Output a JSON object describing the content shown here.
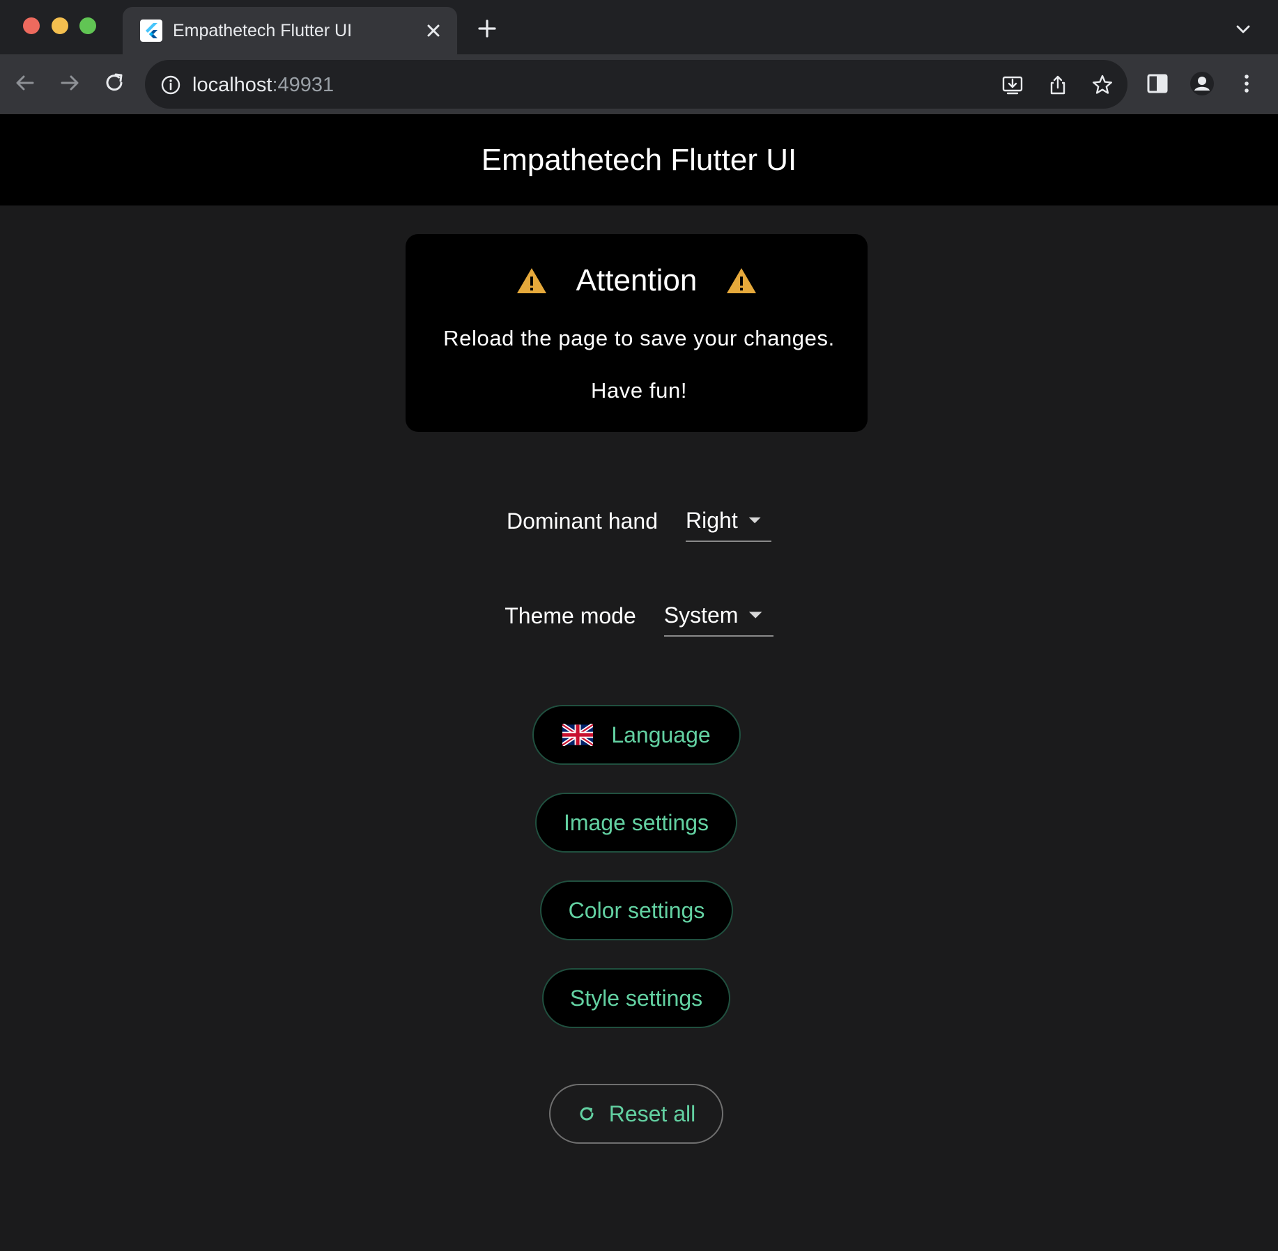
{
  "browser": {
    "tab": {
      "title": "Empathetech Flutter UI"
    },
    "address": {
      "host": "localhost",
      "port": ":49931"
    }
  },
  "app": {
    "title": "Empathetech Flutter UI",
    "attention": {
      "title": "Attention",
      "message": "Reload the page to save your changes.",
      "subtitle": "Have fun!"
    },
    "settings": {
      "dominant_hand": {
        "label": "Dominant hand",
        "value": "Right"
      },
      "theme_mode": {
        "label": "Theme mode",
        "value": "System"
      }
    },
    "buttons": {
      "language": "Language",
      "image_settings": "Image settings",
      "color_settings": "Color settings",
      "style_settings": "Style settings",
      "reset_all": "Reset all"
    }
  },
  "colors": {
    "accent": "#63d1a2",
    "warning": "#e6a93b",
    "app_bar": "#000000",
    "page_bg": "#1b1b1c"
  },
  "icons": {
    "warning": "warning-icon",
    "flag": "uk-flag-icon",
    "reset": "refresh-icon"
  }
}
